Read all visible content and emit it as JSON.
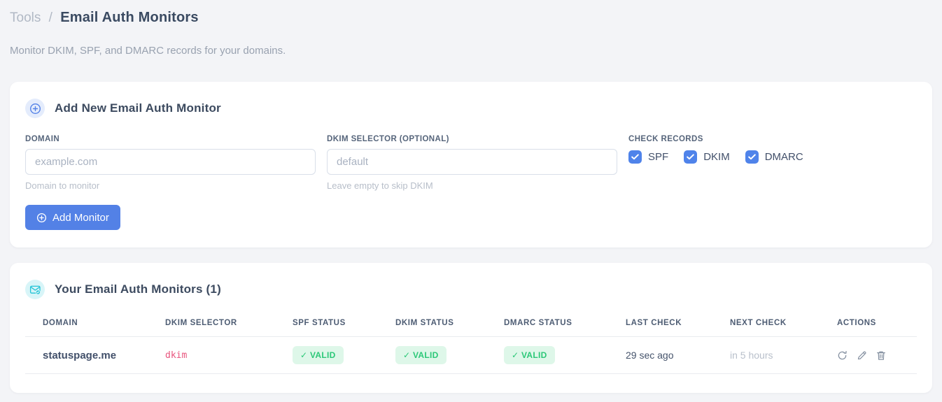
{
  "page": {
    "breadcrumb": "Tools",
    "breadcrumb_separator": "/",
    "title": "Email Auth Monitors",
    "subtitle": "Monitor DKIM, SPF, and DMARC records for your domains."
  },
  "add_monitor_card": {
    "title": "Add New Email Auth Monitor",
    "fields": {
      "domain": {
        "label": "DOMAIN",
        "placeholder": "example.com",
        "value": "",
        "helper": "Domain to monitor"
      },
      "dkim_selector": {
        "label": "DKIM SELECTOR (OPTIONAL)",
        "placeholder": "default",
        "value": "",
        "helper": "Leave empty to skip DKIM"
      }
    },
    "check_records": {
      "label": "CHECK RECORDS",
      "options": [
        {
          "label": "SPF",
          "checked": true
        },
        {
          "label": "DKIM",
          "checked": true
        },
        {
          "label": "DMARC",
          "checked": true
        }
      ]
    },
    "submit_label": "Add Monitor"
  },
  "monitors_card": {
    "title": "Your Email Auth Monitors (1)",
    "table": {
      "columns": [
        "DOMAIN",
        "DKIM SELECTOR",
        "SPF STATUS",
        "DKIM STATUS",
        "DMARC STATUS",
        "LAST CHECK",
        "NEXT CHECK",
        "ACTIONS"
      ],
      "rows": [
        {
          "domain": "statuspage.me",
          "dkim_selector": "dkim",
          "spf_status": "✓ VALID",
          "dkim_status": "✓ VALID",
          "dmarc_status": "✓ VALID",
          "last_check": "29 sec ago",
          "next_check": "in 5 hours"
        }
      ]
    }
  },
  "colors": {
    "accent_blue": "#5381e6",
    "checkbox_blue": "#4f83ea",
    "badge_green_bg": "#def7e9",
    "badge_green_text": "#2cc878",
    "selector_pink": "#e8547d",
    "icon_teal": "#22c3d6",
    "page_background": "#f3f4f7"
  }
}
